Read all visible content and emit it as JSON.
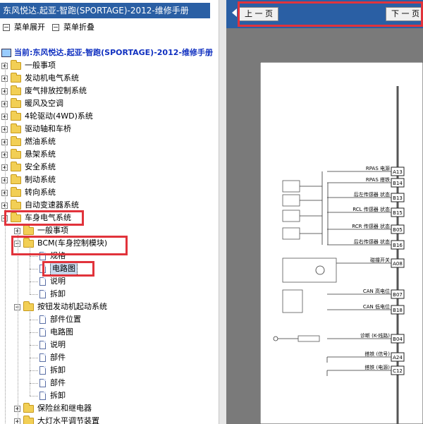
{
  "title": "东风悦达.起亚-智跑(SPORTAGE)-2012-维修手册",
  "menu": {
    "expand": "菜单展开",
    "collapse": "菜单折叠"
  },
  "current": "当前:东风悦达.起亚-智跑(SPORTAGE)-2012-维修手册",
  "tree": {
    "top": [
      "一般事项",
      "发动机电气系统",
      "废气排放控制系统",
      "暖风及空调",
      "4轮驱动(4WD)系统",
      "驱动轴和车桥",
      "燃油系统",
      "悬架系统",
      "安全系统",
      "制动系统",
      "转向系统",
      "自动变速器系统",
      "车身电气系统"
    ],
    "body_children": [
      "一般事项",
      "BCM(车身控制模块)"
    ],
    "bcm_children": [
      "规格",
      "电路图",
      "说明",
      "拆卸"
    ],
    "button_group": "按钮发动机起动系统",
    "button_children": [
      "部件位置",
      "电路图",
      "说明",
      "部件",
      "拆卸",
      "部件",
      "拆卸"
    ],
    "more": [
      "保险丝和继电器",
      "大灯水平调节装置"
    ]
  },
  "nav": {
    "prev": "上 一 页",
    "next": "下 一 页"
  },
  "diagram": {
    "pins": [
      {
        "pin": "A13",
        "label": "RPAS 电源"
      },
      {
        "pin": "B14",
        "label": "RPAS 搭铁"
      },
      {
        "pin": "B13",
        "label": "后左传感器 状态"
      },
      {
        "pin": "B15",
        "label": "RCL 传感器 状态"
      },
      {
        "pin": "B05",
        "label": "RCR 传感器 状态"
      },
      {
        "pin": "B16",
        "label": "后右传感器 状态"
      },
      {
        "pin": "A08",
        "label": "碰撞开关"
      },
      {
        "pin": "B07",
        "label": "CAN 高电位"
      },
      {
        "pin": "B18",
        "label": "CAN 低电位"
      },
      {
        "pin": "B04",
        "label": "诊断 (K-线路)"
      },
      {
        "pin": "A24",
        "label": "搭铁 (信号)"
      },
      {
        "pin": "C12",
        "label": "搭铁 (电源)"
      }
    ]
  }
}
